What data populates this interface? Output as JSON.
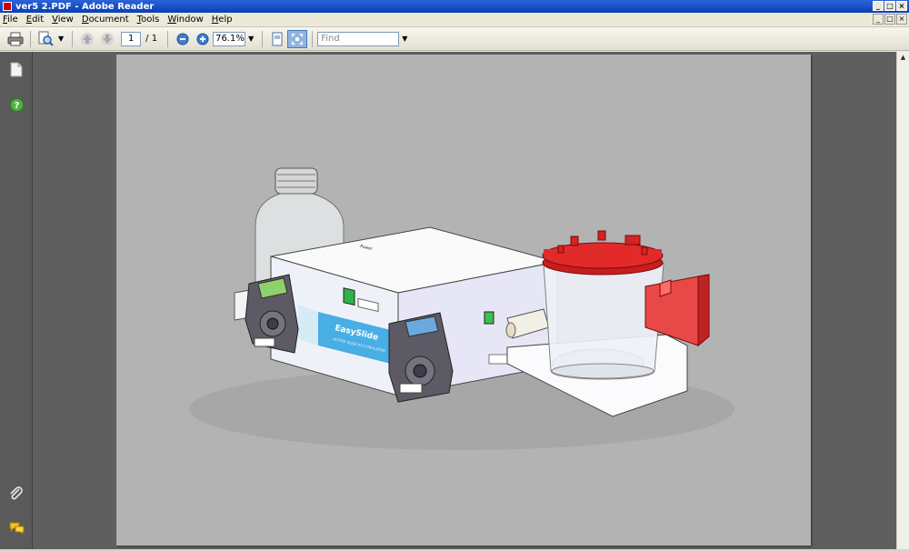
{
  "window": {
    "title": "ver5 2.PDF - Adobe Reader"
  },
  "window_buttons": {
    "minimize": "_",
    "maximize": "□",
    "close": "×"
  },
  "menu": [
    {
      "accel": "F",
      "rest": "ile"
    },
    {
      "accel": "E",
      "rest": "dit"
    },
    {
      "accel": "V",
      "rest": "iew"
    },
    {
      "accel": "D",
      "rest": "ocument"
    },
    {
      "accel": "T",
      "rest": "ools"
    },
    {
      "accel": "W",
      "rest": "indow"
    },
    {
      "accel": "H",
      "rest": "elp"
    }
  ],
  "toolbar": {
    "page_current": "1",
    "page_total": "/ 1",
    "zoom": "76.1%",
    "find_placeholder": "Find"
  },
  "device": {
    "power_label": "Power",
    "brand_name": "EasySlide",
    "brand_tagline": "ACTIVE SLIDE ACCUMULATOR"
  },
  "colors": {
    "nav_pane": "#5a5a5a",
    "doc_background": "#5f5f5f",
    "page_background": "#b3b3b3",
    "lid_red": "#e32a2a",
    "brand_blue": "#35a6e0"
  }
}
